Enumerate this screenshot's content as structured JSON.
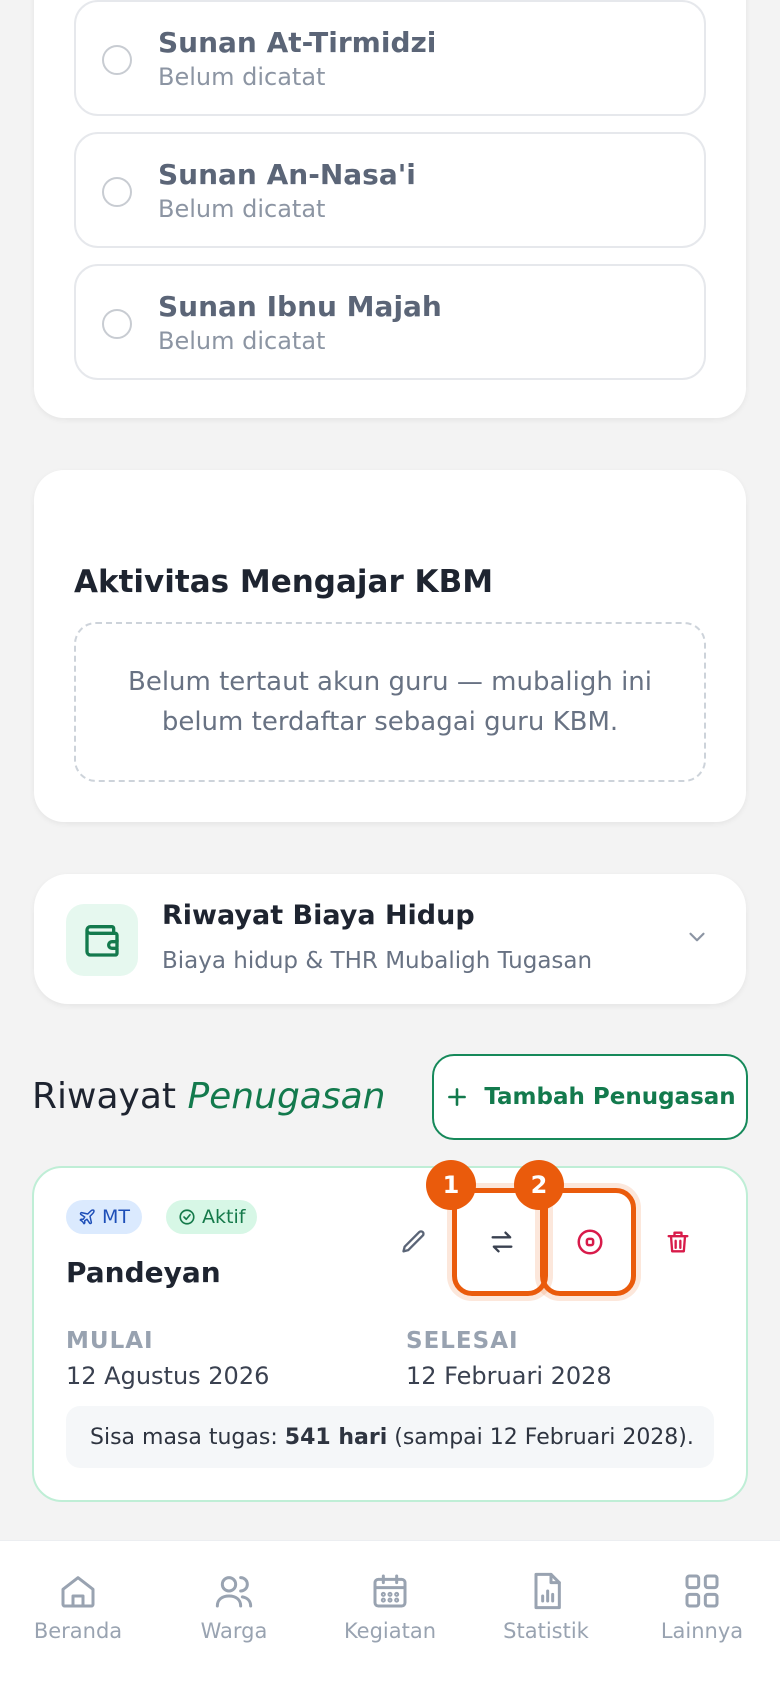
{
  "hadith_books": [
    {
      "title": "Sunan At-Tirmidzi",
      "status": "Belum dicatat"
    },
    {
      "title": "Sunan An-Nasa'i",
      "status": "Belum dicatat"
    },
    {
      "title": "Sunan Ibnu Majah",
      "status": "Belum dicatat"
    }
  ],
  "kbm": {
    "title": "Aktivitas Mengajar KBM",
    "empty_message": "Belum tertaut akun guru — mubaligh ini belum terdaftar sebagai guru KBM."
  },
  "biaya": {
    "title": "Riwayat Biaya Hidup",
    "subtitle": "Biaya hidup & THR Mubaligh Tugasan",
    "icon": "wallet-icon"
  },
  "riwayat": {
    "title_plain": "Riwayat",
    "title_italic": "Penugasan",
    "add_button_label": "Tambah Penugasan"
  },
  "assignment": {
    "badge_type": "MT",
    "badge_status": "Aktif",
    "place": "Pandeyan",
    "start_label": "MULAI",
    "start_date": "12 Agustus 2026",
    "end_label": "SELESAI",
    "end_date": "12 Februari 2028",
    "sisa_prefix": "Sisa masa tugas:",
    "sisa_days": "541 hari",
    "sisa_suffix": "(sampai 12 Februari 2028).",
    "highlight_1": "1",
    "highlight_2": "2"
  },
  "colors": {
    "accent_green": "#137a4d",
    "highlight_orange": "#ea5b0c",
    "danger_red": "#d81b4a"
  },
  "nav": [
    {
      "label": "Beranda",
      "icon": "home-icon"
    },
    {
      "label": "Warga",
      "icon": "users-icon"
    },
    {
      "label": "Kegiatan",
      "icon": "calendar-icon"
    },
    {
      "label": "Statistik",
      "icon": "stats-icon"
    },
    {
      "label": "Lainnya",
      "icon": "grid-icon"
    }
  ]
}
